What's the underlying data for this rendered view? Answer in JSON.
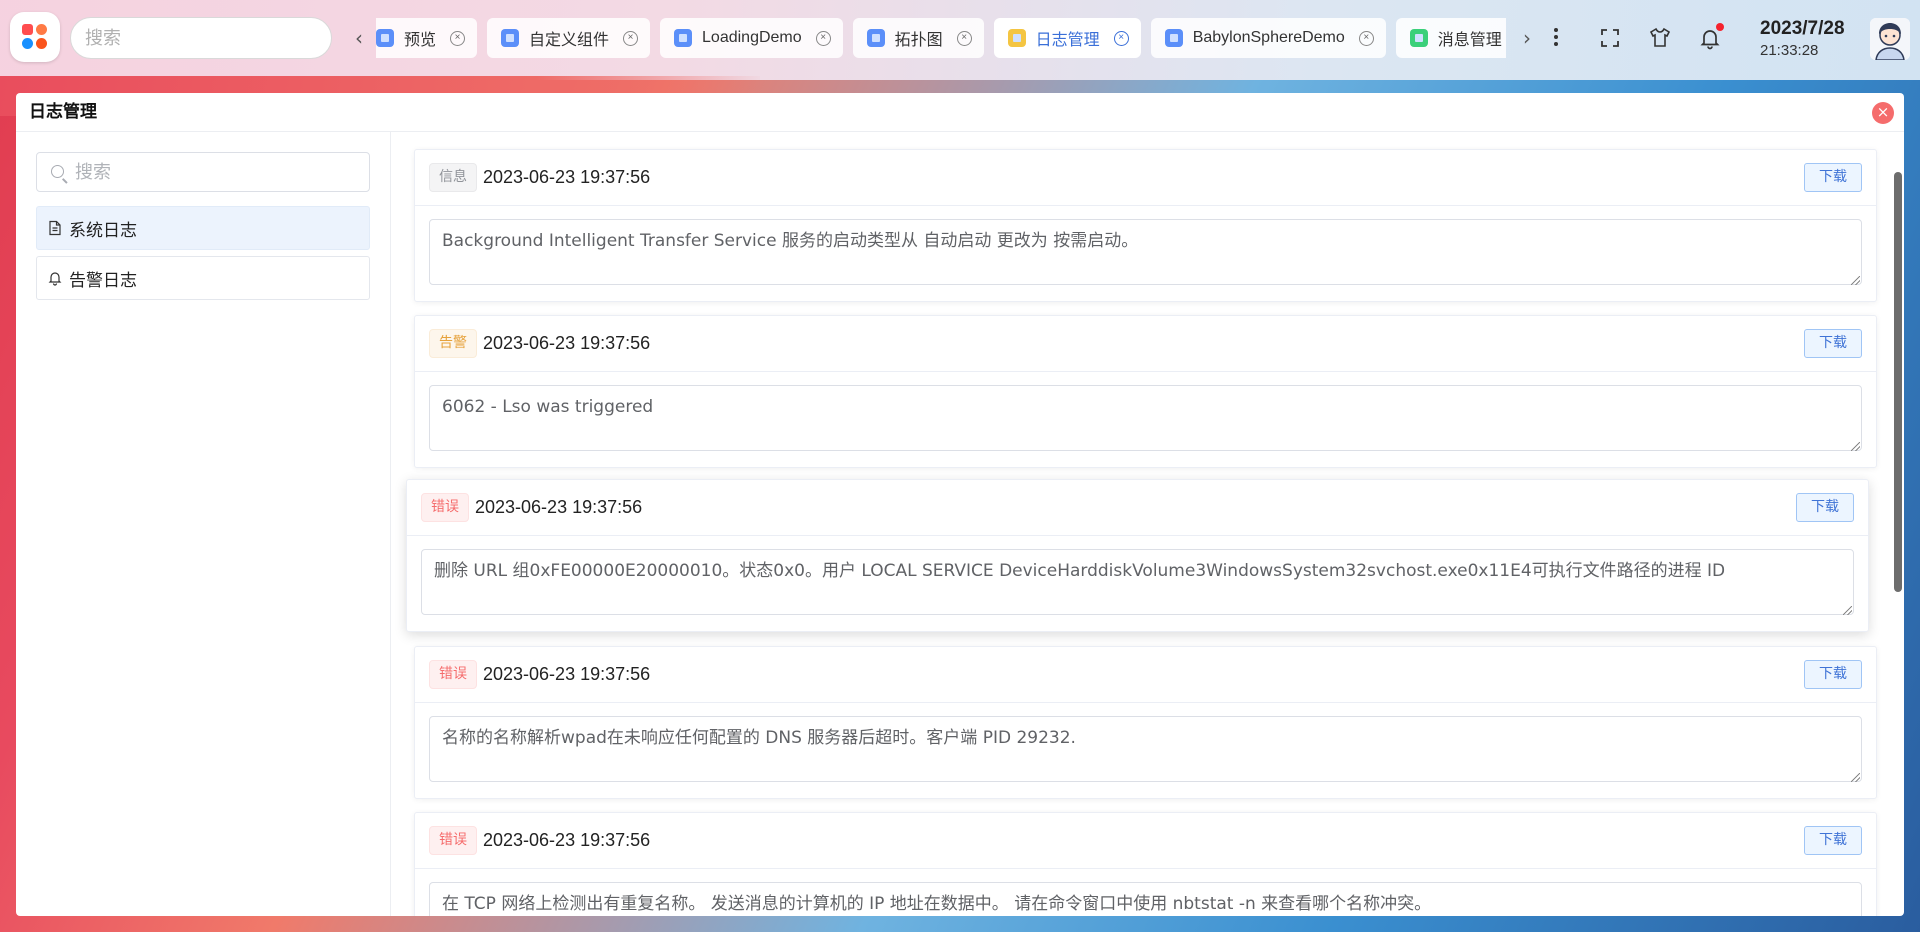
{
  "topbar": {
    "search_placeholder": "搜索",
    "tabs": [
      {
        "label": "预览",
        "icon": "cube-icon",
        "active": false
      },
      {
        "label": "自定义组件",
        "icon": "cube-icon",
        "active": false
      },
      {
        "label": "LoadingDemo",
        "icon": "cube-icon",
        "active": false
      },
      {
        "label": "拓扑图",
        "icon": "cube-icon",
        "active": false
      },
      {
        "label": "日志管理",
        "icon": "log-icon",
        "active": true
      },
      {
        "label": "BabylonSphereDemo",
        "icon": "cube-icon",
        "active": false
      },
      {
        "label": "消息管理",
        "icon": "bell-icon",
        "active": false
      }
    ],
    "date": "2023/7/28",
    "time": "21:33:28",
    "accent_color": "#3a6fd8",
    "notification_dot_color": "#f5222d"
  },
  "window": {
    "title": "日志管理"
  },
  "sidebar": {
    "search_placeholder": "搜索",
    "items": [
      {
        "label": "系统日志",
        "icon": "document-icon",
        "active": true
      },
      {
        "label": "告警日志",
        "icon": "bell-icon",
        "active": false
      }
    ]
  },
  "logs": [
    {
      "level": "信息",
      "level_type": "info",
      "time": "2023-06-23 19:37:56",
      "message": "Background Intelligent Transfer Service 服务的启动类型从 自动启动 更改为 按需启动。",
      "button": "下载"
    },
    {
      "level": "告警",
      "level_type": "warn",
      "time": "2023-06-23 19:37:56",
      "message": "6062 - Lso was triggered",
      "button": "下载"
    },
    {
      "level": "错误",
      "level_type": "error",
      "time": "2023-06-23 19:37:56",
      "message": "删除 URL 组0xFE00000E20000010。状态0x0。用户 LOCAL SERVICE DeviceHarddiskVolume3WindowsSystem32svchost.exe0x11E4可执行文件路径的进程 ID",
      "button": "下载"
    },
    {
      "level": "错误",
      "level_type": "error",
      "time": "2023-06-23 19:37:56",
      "message": "名称的名称解析wpad在未响应任何配置的 DNS 服务器后超时。客户端 PID 29232.",
      "button": "下载"
    },
    {
      "level": "错误",
      "level_type": "error",
      "time": "2023-06-23 19:37:56",
      "message": "在 TCP 网络上检测出有重复名称。 发送消息的计算机的 IP 地址在数据中。 请在命令窗口中使用 nbtstat -n 来查看哪个名称冲突。",
      "button": "下载"
    }
  ]
}
